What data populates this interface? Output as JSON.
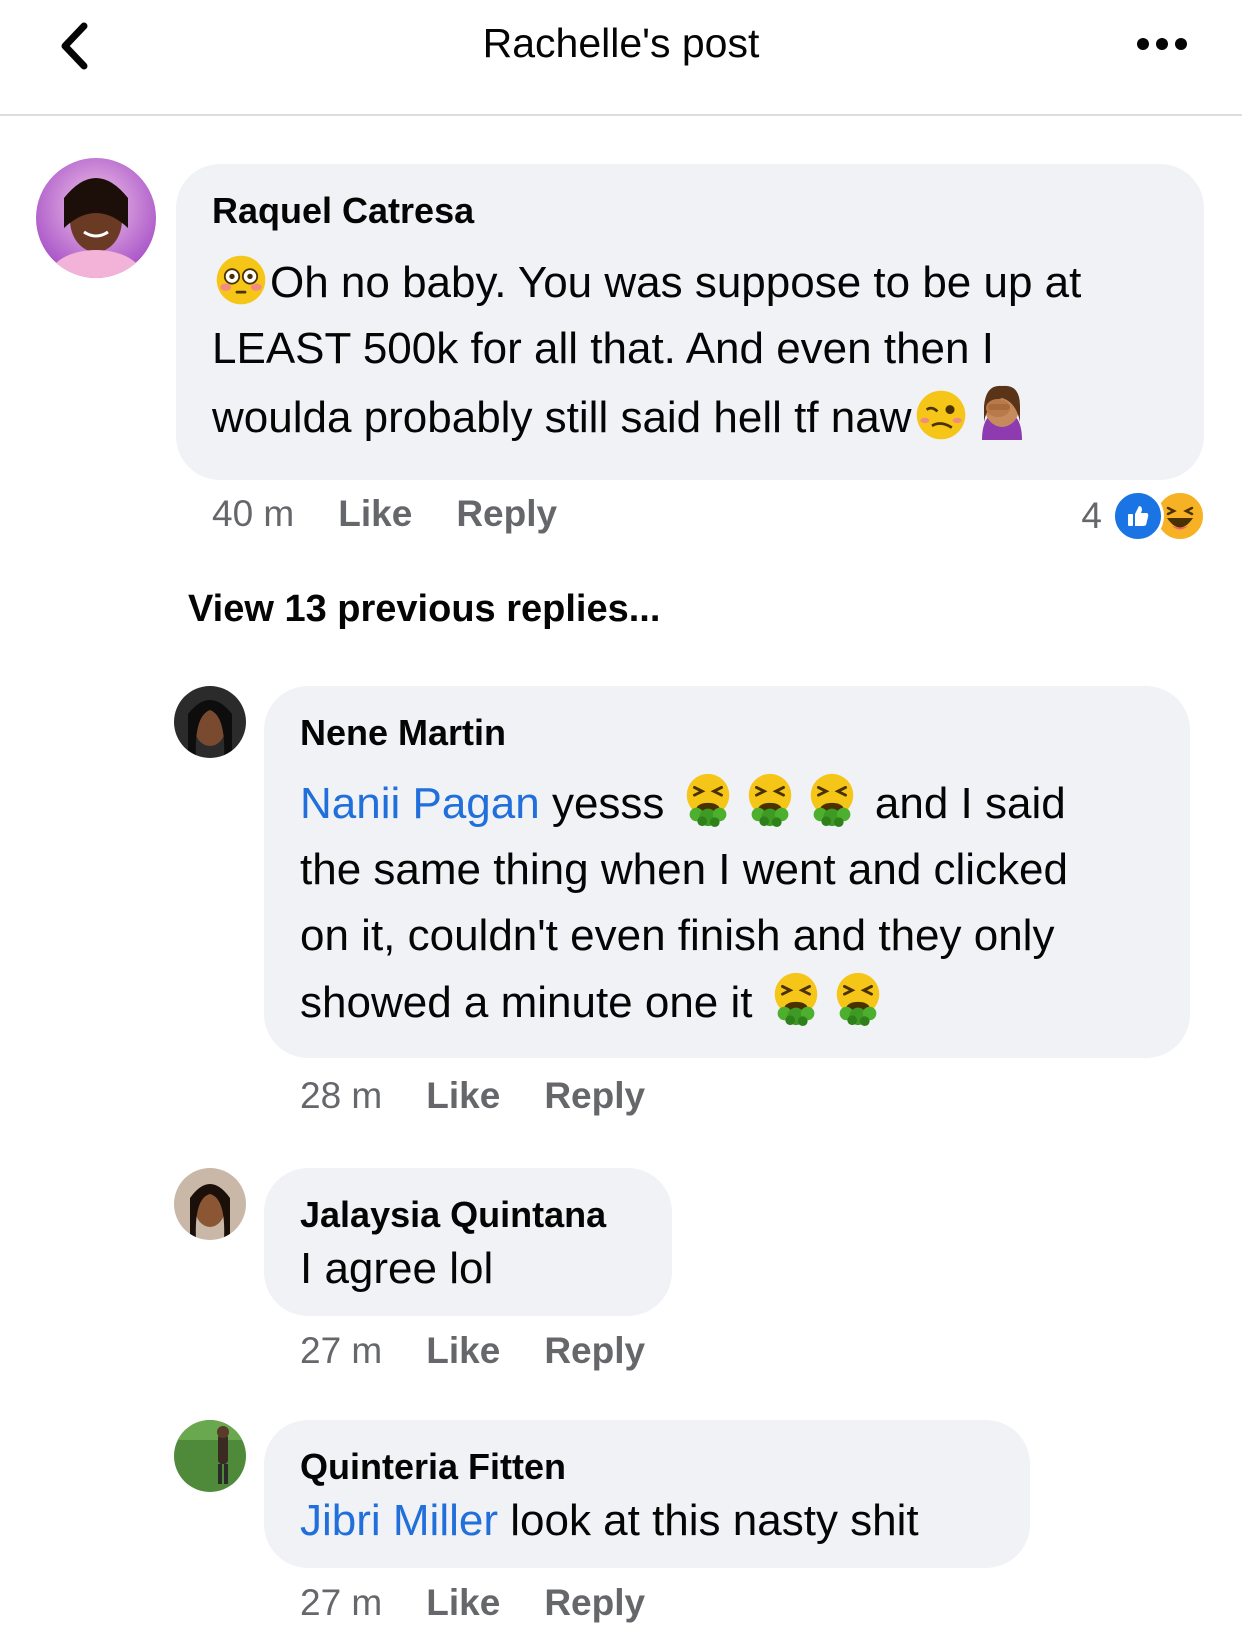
{
  "header": {
    "title": "Rachelle's post"
  },
  "comments": [
    {
      "author": "Raquel Catresa",
      "lines": [
        "Oh no baby. You was suppose to be up at",
        "LEAST 500k for all that.  And even then I",
        "woulda probably still said hell tf naw"
      ],
      "time": "40 m",
      "like": "Like",
      "reply": "Reply",
      "reaction_count": "4",
      "emojis": [
        "flushed-face",
        "woozy-face",
        "facepalm"
      ]
    }
  ],
  "view_previous": "View 13 previous replies...",
  "replies": [
    {
      "author": "Nene Martin",
      "mention": "Nanii Pagan",
      "line1_after_mention": " yesss ",
      "line1_tail": " and I said",
      "lines": [
        "the same thing when I went and clicked",
        "on it, couldn't even finish and they only",
        "showed a minute one it "
      ],
      "time": "28 m",
      "like": "Like",
      "reply": "Reply",
      "emojis": [
        "nauseated-face"
      ]
    },
    {
      "author": "Jalaysia Quintana",
      "text": "I agree lol",
      "time": "27 m",
      "like": "Like",
      "reply": "Reply"
    },
    {
      "author": "Quinteria Fitten",
      "mention": "Jibri Miller",
      "text": " look at this nasty shit",
      "time": "27 m",
      "like": "Like",
      "reply": "Reply"
    }
  ]
}
